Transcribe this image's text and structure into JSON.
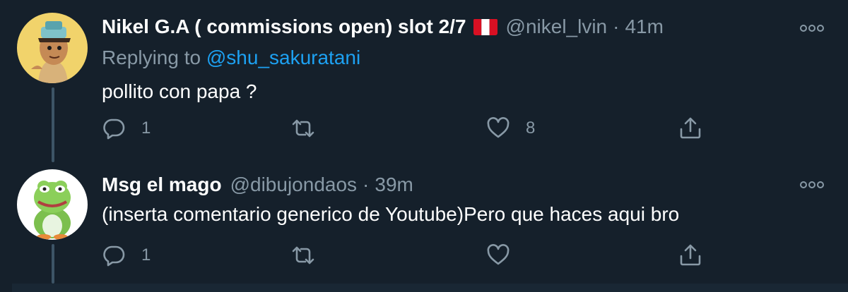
{
  "tweets": [
    {
      "name": "Nikel G.A ( commissions open) slot 2/7",
      "flag": "peru-flag-emoji",
      "handle": "@nikel_lvin",
      "separator": "·",
      "time": "41m",
      "replying_prefix": "Replying to",
      "replying_to": "@shu_sakuratani",
      "text": "pollito con papa ?",
      "reply_count": "1",
      "retweet_count": "",
      "like_count": "8"
    },
    {
      "name": "Msg el mago",
      "handle": "@dibujondaos",
      "separator": "·",
      "time": "39m",
      "text": "(inserta comentario generico de Youtube)Pero que haces aqui bro",
      "reply_count": "1",
      "retweet_count": "",
      "like_count": ""
    }
  ],
  "colors": {
    "background": "#15202b",
    "text_primary": "#ffffff",
    "text_secondary": "#8899a6",
    "link": "#1da1f2",
    "thread_line": "#3d5466"
  },
  "icons": [
    "reply-icon",
    "retweet-icon",
    "like-icon",
    "share-icon",
    "more-icon"
  ]
}
